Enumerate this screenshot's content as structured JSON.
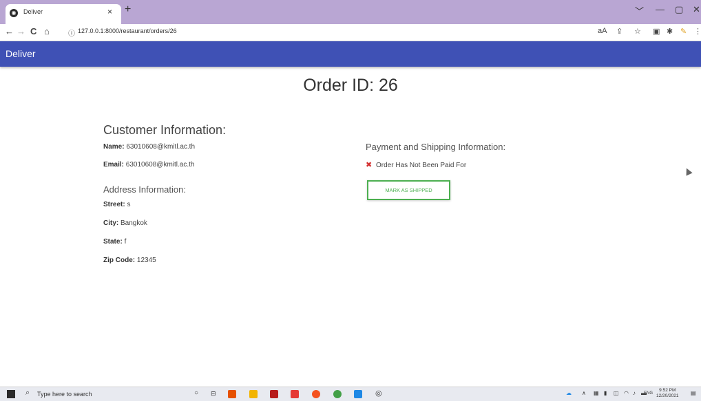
{
  "browser": {
    "tab_title": "Deliver",
    "tab_close": "×",
    "new_tab": "+",
    "url": "127.0.0.1:8000/restaurant/orders/26",
    "window_controls": [
      "﹀",
      "—",
      "▢",
      "✕"
    ],
    "nav_icons": [
      "←",
      "→",
      "C",
      "⌂",
      "ⓘ"
    ],
    "toolbar_icons": [
      "aA",
      "⇪",
      "☆",
      "▣",
      "✱",
      "✎",
      "⋮"
    ]
  },
  "app": {
    "brand": "Deliver",
    "accent_color": "#3f51b5"
  },
  "order": {
    "title": "Order ID: 26"
  },
  "customer": {
    "heading": "Customer Information:",
    "name_label": "Name:",
    "name_value": "63010608@kmitl.ac.th",
    "email_label": "Email:",
    "email_value": "63010608@kmitl.ac.th"
  },
  "address": {
    "heading": "Address Information:",
    "street_label": "Street:",
    "street_value": "s",
    "city_label": "City:",
    "city_value": "Bangkok",
    "state_label": "State:",
    "state_value": "f",
    "zip_label": "Zip Code:",
    "zip_value": "12345"
  },
  "payment": {
    "heading": "Payment and Shipping Information:",
    "status_icon": "✖",
    "status_text": "Order Has Not Been Paid For",
    "ship_button": "MARK AS SHIPPED",
    "status_color": "#d32f2f",
    "button_color": "#4caf50"
  },
  "taskbar": {
    "search_placeholder": "Type here to search",
    "language": "ENG",
    "time": "9:52 PM",
    "date": "12/20/2021"
  }
}
